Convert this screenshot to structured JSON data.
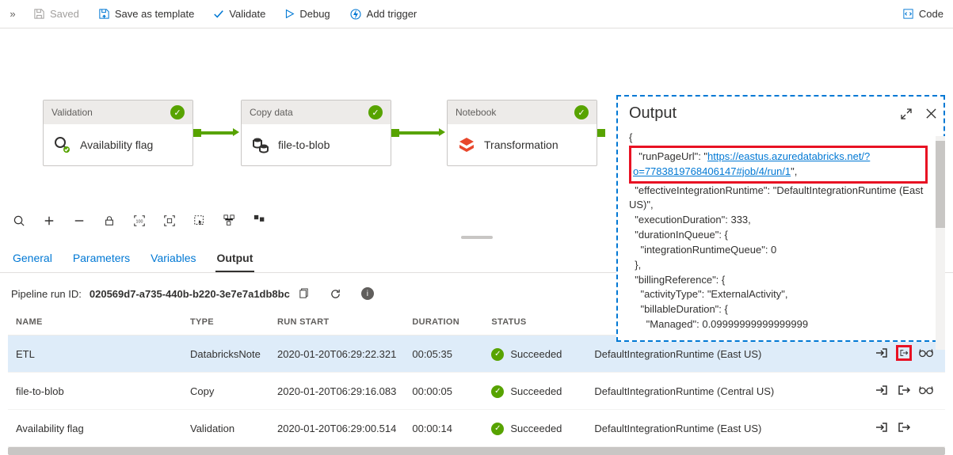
{
  "toolbar": {
    "expand_icon": "»",
    "saved": "Saved",
    "save_as_template": "Save as template",
    "validate": "Validate",
    "debug": "Debug",
    "add_trigger": "Add trigger",
    "code": "Code"
  },
  "activities": [
    {
      "type": "Validation",
      "name": "Availability flag",
      "icon": "search"
    },
    {
      "type": "Copy data",
      "name": "file-to-blob",
      "icon": "database"
    },
    {
      "type": "Notebook",
      "name": "Transformation",
      "icon": "databricks"
    }
  ],
  "output_panel": {
    "title": "Output",
    "json_open": "{",
    "key1": "  \"runPageUrl\": \"",
    "url": "https://eastus.azuredatabricks.net/?o=7783819768406147#job/4/run/1",
    "key1_close": "\",",
    "rest": "  \"effectiveIntegrationRuntime\": \"DefaultIntegrationRuntime (East US)\",\n  \"executionDuration\": 333,\n  \"durationInQueue\": {\n    \"integrationRuntimeQueue\": 0\n  },\n  \"billingReference\": {\n    \"activityType\": \"ExternalActivity\",\n    \"billableDuration\": {\n      \"Managed\": 0.09999999999999999"
  },
  "tabs": {
    "general": "General",
    "parameters": "Parameters",
    "variables": "Variables",
    "output": "Output"
  },
  "runid": {
    "label": "Pipeline run ID:",
    "value": "020569d7-a735-440b-b220-3e7e7a1db8bc"
  },
  "table": {
    "headers": {
      "name": "NAME",
      "type": "TYPE",
      "run_start": "RUN START",
      "duration": "DURATION",
      "status": "STATUS",
      "runtime": ""
    },
    "rows": [
      {
        "name": "ETL",
        "type": "DatabricksNote",
        "run_start": "2020-01-20T06:29:22.321",
        "duration": "00:05:35",
        "status": "Succeeded",
        "runtime": "DefaultIntegrationRuntime (East US)",
        "highlighted": true,
        "glasses": true
      },
      {
        "name": "file-to-blob",
        "type": "Copy",
        "run_start": "2020-01-20T06:29:16.083",
        "duration": "00:00:05",
        "status": "Succeeded",
        "runtime": "DefaultIntegrationRuntime (Central US)",
        "highlighted": false,
        "glasses": true
      },
      {
        "name": "Availability flag",
        "type": "Validation",
        "run_start": "2020-01-20T06:29:00.514",
        "duration": "00:00:14",
        "status": "Succeeded",
        "runtime": "DefaultIntegrationRuntime (East US)",
        "highlighted": false,
        "glasses": false
      }
    ]
  }
}
